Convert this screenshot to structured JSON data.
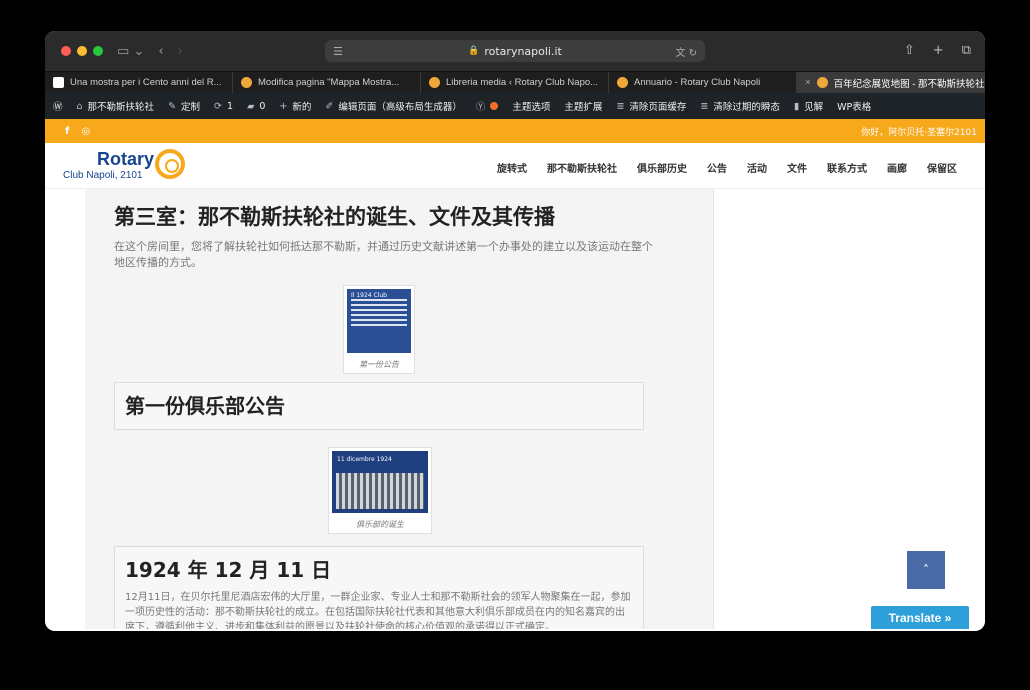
{
  "browser": {
    "url": "rotarynapoli.it",
    "tabs": [
      {
        "title": "Una mostra per i Cento anni del R..."
      },
      {
        "title": "Modifica pagina \"Mappa Mostra..."
      },
      {
        "title": "Libreria media ‹ Rotary Club Napo..."
      },
      {
        "title": "Annuario - Rotary Club Napoli"
      },
      {
        "title": "百年纪念展览地图 - 那不勒斯扶轮社",
        "active": true
      }
    ]
  },
  "adminbar": {
    "site": "那不勒斯扶轮社",
    "customize": "定制",
    "updates": "1",
    "comments": "0",
    "new": "新的",
    "edit": "编辑页面（高级布局生成器）",
    "theme_options": "主题选项",
    "theme_ext": "主题扩展",
    "clear_cache": "清除页面缓存",
    "clear_transients": "清除过期的瞬态",
    "insights": "见解",
    "wp_tables": "WP表格"
  },
  "socialbar": {
    "greeting": "你好，阿尔贝托·圣塞尔2101"
  },
  "site": {
    "logo_title": "Rotary",
    "logo_sub": "Club Napoli, 2101",
    "nav": [
      "旋转式",
      "那不勒斯扶轮社",
      "俱乐部历史",
      "公告",
      "活动",
      "文件",
      "联系方式",
      "画廊",
      "保留区"
    ]
  },
  "content": {
    "heading": "第三室：那不勒斯扶轮社的诞生、文件及其传播",
    "intro": "在这个房间里，您将了解扶轮社如何抵达那不勒斯，并通过历史文献讲述第一个办事处的建立以及该运动在整个地区传播的方式。",
    "fig1_caption": "第一份公告",
    "fig1_label": "Il 1924 Club",
    "section1_title": "第一份俱乐部公告",
    "fig2_label": "11 dicembre 1924",
    "fig2_caption": "俱乐部的诞生",
    "section2_title": "1924 年 12 月 11 日",
    "section2_text": "12月11日，在贝尔托里尼酒店宏伟的大厅里，一群企业家、专业人士和那不勒斯社会的领军人物聚集在一起，参加一项历史性的活动：那不勒斯扶轮社的成立。在包括国际扶轮社代表和其他意大利俱乐部成员在内的知名嘉宾的出席下，遵循利他主义、进步和集体利益的愿景以及扶轮社使命的核心价值观的承诺得以正式确定。"
  },
  "widgets": {
    "to_top": "˄",
    "translate": "Translate »"
  }
}
